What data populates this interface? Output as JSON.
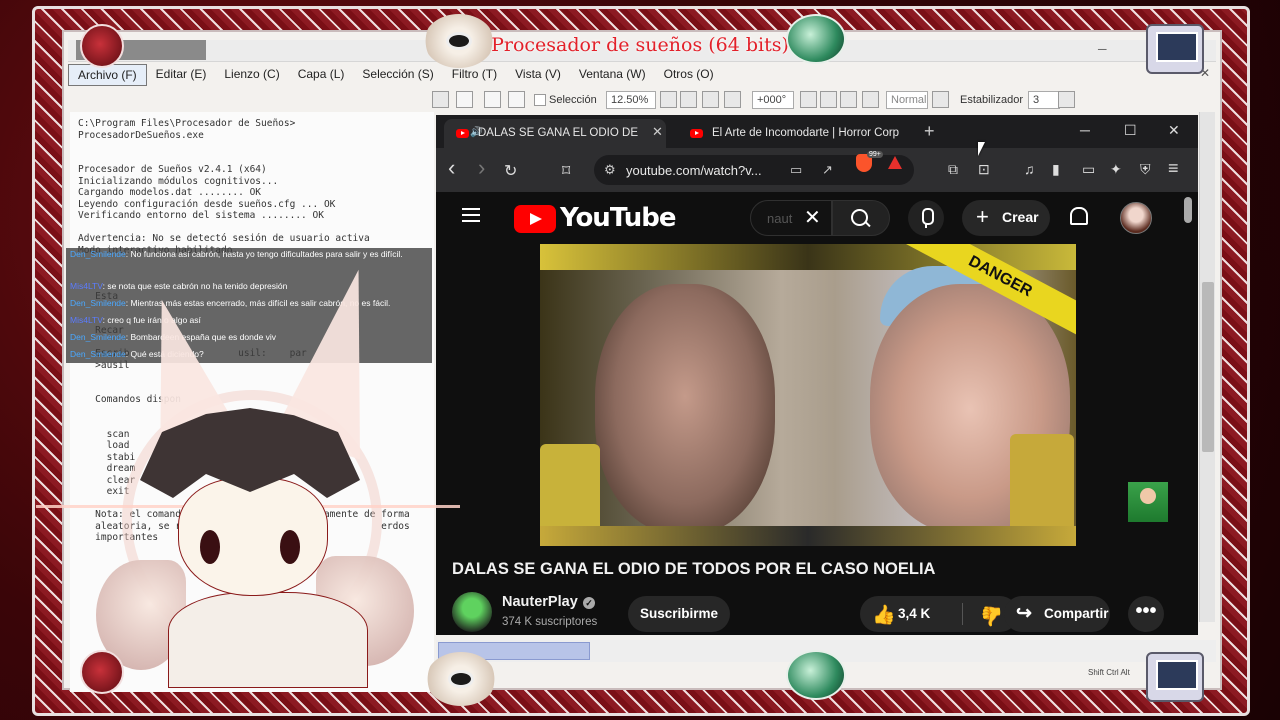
{
  "frame": {
    "title": "Procesador de sueños (64 bits)",
    "accent_red": "#e3202a",
    "frame_maroon": "#7a0f16"
  },
  "app": {
    "menu": [
      "Archivo (F)",
      "Editar (E)",
      "Lienzo (C)",
      "Capa (L)",
      "Selección (S)",
      "Filtro (T)",
      "Vista (V)",
      "Ventana (W)",
      "Otros (O)"
    ],
    "toolbar": {
      "selection_label": "Selección",
      "zoom": "12.50%",
      "angle": "+000°",
      "blend": "Normal",
      "stabilizer_label": "Estabilizador",
      "stabilizer_value": "3"
    },
    "console_text": "C:\\Program Files\\Procesador de Sueños>\nProcesadorDeSueños.exe\n\n\nProcesador de Sueños v2.4.1 (x64)\nInicializando módulos cognitivos...\nCargando modelos.dat ........ OK\nLeyendo configuración desde sueños.cfg ... OK\nVerificando entorno del sistema ........ OK\n\nAdvertencia: No se detectó sesión de usuario activa\nModo interactivo habilitado.\n\n\n\n   Esta\n\n\n   Recar\n\n   Escrib                   usil:    par\n   >ausil\n\n\n   Comandos dispon\n\n\n     scan\n     load\n     stabi\n     dream\n     clear\n     exit\n\n   Nota: el comando                    aticamente de forma\n   aleatoria, se recomi                              erdos\n   importantes",
    "status_keys": "Shift Ctrl Alt"
  },
  "chat": [
    {
      "user": "Den_Smilende",
      "sep": ": ",
      "text": "No funciona así cabrón, hasta yo tengo dificultades para salir y es difícil.",
      "tall": true,
      "user_class": "u1"
    },
    {
      "user": "Mis4LTV",
      "sep": ": ",
      "text": "se nota que este cabrón no ha tenido depresión",
      "tall": false,
      "user_class": "u2"
    },
    {
      "user": "Den_Smilende",
      "sep": ": ",
      "text": "Mientras más estas encerrado, más difícil es salir cabrón, no es fácil.",
      "tall": false,
      "user_class": "u1"
    },
    {
      "user": "Mis4LTV",
      "sep": ": ",
      "text": "creo q fue irán o algo así",
      "tall": false,
      "user_class": "u2"
    },
    {
      "user": "Den_Smilende",
      "sep": ": ",
      "text": "Bombardeen españa que es donde viv",
      "tall": false,
      "user_class": "u1"
    },
    {
      "user": "Den_Smilende",
      "sep": ": ",
      "text": "Qué está diciendo?",
      "tall": false,
      "user_class": "u1"
    }
  ],
  "browser": {
    "tabs": [
      {
        "label": "DALAS SE GANA EL ODIO DE",
        "active": true
      },
      {
        "label": "El Arte de Incomodarte | Horror Corp",
        "active": false
      }
    ],
    "new_tab": "+",
    "url": "youtube.com/watch?v...",
    "brave_badge": "99+"
  },
  "youtube": {
    "logo_text": "YouTube",
    "search_value": "naut",
    "create_label": "Crear",
    "video_overlay_text": "DANGER",
    "video_title": "DALAS SE GANA EL ODIO DE TODOS POR EL CASO NOELIA",
    "channel_name": "NauterPlay",
    "verified_mark": "✓",
    "subscribers": "374 K suscriptores",
    "subscribe_label": "Suscribirme",
    "likes": "3,4 K",
    "share_label": "Compartir",
    "more_label": "•••"
  },
  "icons": {
    "nav_back": "‹",
    "nav_forward": "›",
    "reload": "↻",
    "bookmark": "⌑",
    "site_settings": "⚙",
    "like": "👍",
    "dislike": "👍",
    "share": "↪",
    "close": "✕",
    "minimize": "─",
    "maximize": "☐",
    "extensions": "⧉",
    "music": "♫",
    "sidebar": "▮",
    "wallet": "▭",
    "leo": "✦",
    "vpn": "⛨",
    "menu": "≡"
  }
}
